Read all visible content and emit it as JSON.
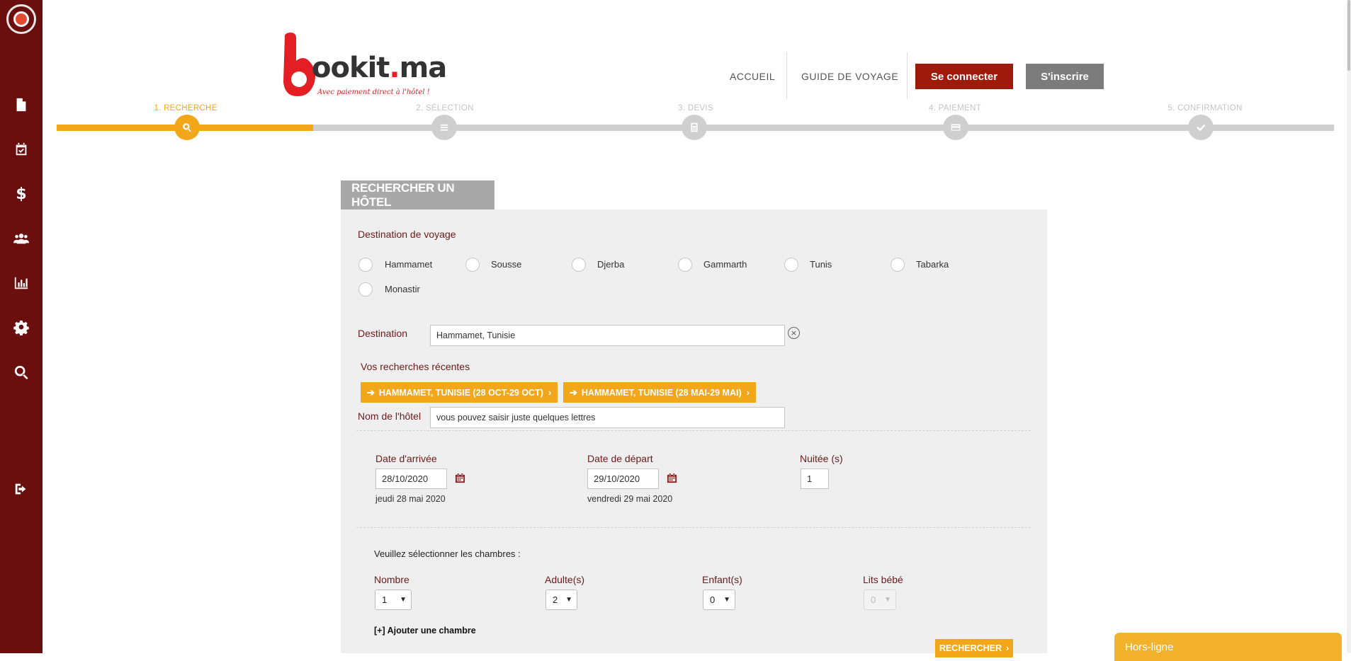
{
  "brand": {
    "name_first_letter": "B",
    "name_rest": "ookit",
    "name_dot": ".",
    "name_tld": "ma",
    "tagline": "Avec paiement direct à l'hôtel !"
  },
  "sidebar": {
    "items": [
      {
        "icon": "document-icon"
      },
      {
        "icon": "calendar-check-icon"
      },
      {
        "icon": "dollar-icon",
        "glyph": "$"
      },
      {
        "icon": "users-icon"
      },
      {
        "icon": "bar-chart-icon"
      },
      {
        "icon": "gear-icon"
      },
      {
        "icon": "search-icon"
      },
      {
        "icon": "sign-out-icon"
      }
    ]
  },
  "nav": {
    "home": "ACCUEIL",
    "guide": "GUIDE DE VOYAGE",
    "login": "Se connecter",
    "signup": "S'inscrire"
  },
  "steps": [
    {
      "label": "1. RECHERCHE",
      "icon": "search-icon",
      "active": true
    },
    {
      "label": "2. SÉLECTION",
      "icon": "list-icon",
      "active": false
    },
    {
      "label": "3. DEVIS",
      "icon": "calculator-icon",
      "active": false
    },
    {
      "label": "4. PAIEMENT",
      "icon": "credit-card-icon",
      "active": false
    },
    {
      "label": "5. CONFIRMATION",
      "icon": "check-icon",
      "active": false
    }
  ],
  "colors": {
    "sidebar": "#6b0e0e",
    "accent": "#f2a71b",
    "login_button": "#9e1b0c",
    "signup_button": "#7c7c7c",
    "label_red": "#6b1a1a"
  },
  "search": {
    "tab_title": "RECHERCHER UN HÔTEL",
    "destination_section_label": "Destination de voyage",
    "destinations": [
      "Hammamet",
      "Sousse",
      "Djerba",
      "Gammarth",
      "Tunis",
      "Tabarka",
      "Monastir"
    ],
    "destination_label": "Destination",
    "destination_value": "Hammamet, Tunisie",
    "recent_label": "Vos recherches récentes",
    "recent": [
      "HAMMAMET, TUNISIE (28 OCT-29 OCT)",
      "HAMMAMET, TUNISIE (28 MAI-29 MAI)"
    ],
    "hotel_name_label": "Nom de l'hôtel",
    "hotel_name_placeholder": "vous pouvez saisir juste quelques lettres",
    "arrival_label": "Date d'arrivée",
    "arrival_value": "28/10/2020",
    "arrival_text": "jeudi 28 mai 2020",
    "departure_label": "Date de départ",
    "departure_value": "29/10/2020",
    "departure_text": "vendredi 29 mai 2020",
    "nights_label": "Nuitée (s)",
    "nights_value": "1",
    "rooms_prompt": "Veuillez sélectionner les chambres :",
    "col_number": "Nombre",
    "col_adults": "Adulte(s)",
    "col_children": "Enfant(s)",
    "col_cribs": "Lits bébé",
    "number_value": "1",
    "adults_value": "2",
    "children_value": "0",
    "cribs_value": "0",
    "add_room": "[+] Ajouter une chambre",
    "submit": "RECHERCHER"
  },
  "chat": {
    "status": "Hors-ligne"
  }
}
